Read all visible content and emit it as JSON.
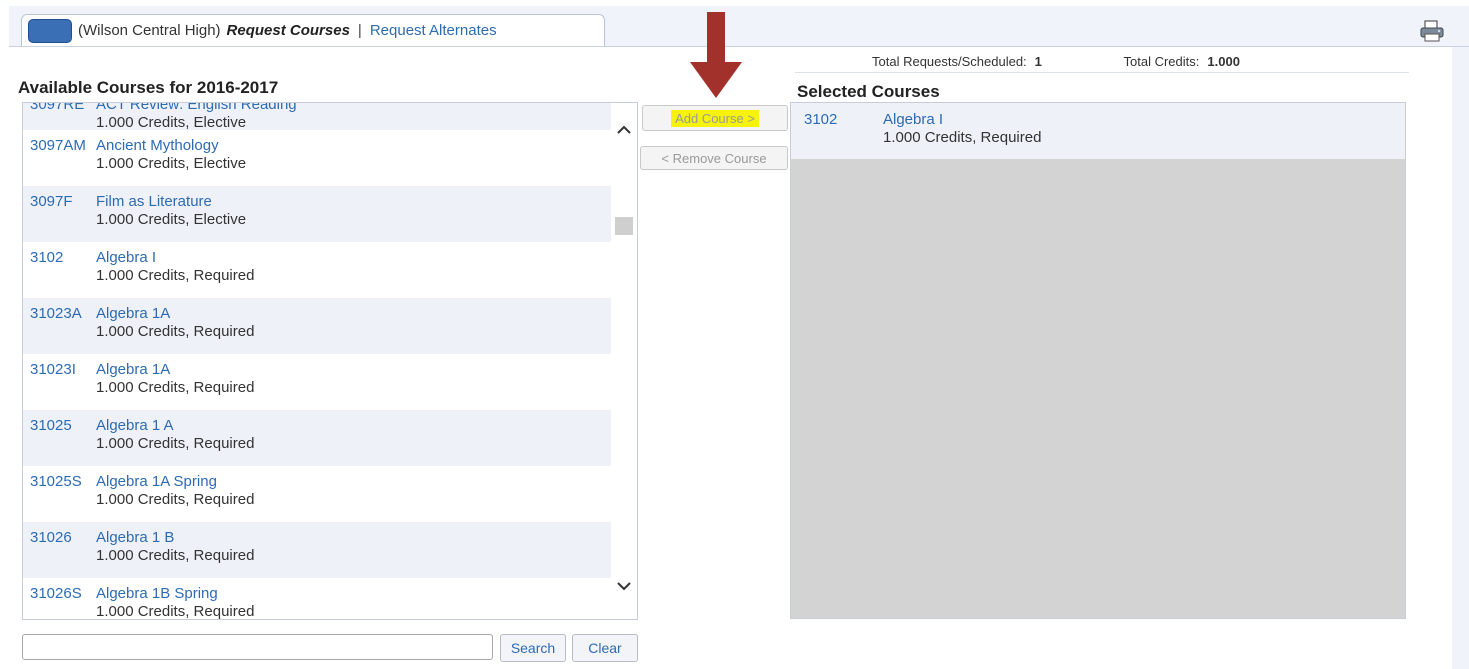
{
  "tab": {
    "school": "(Wilson Central High)",
    "active": "Request Courses",
    "separator": "|",
    "link": "Request Alternates"
  },
  "available": {
    "title": "Available Courses for 2016-2017",
    "partial_first": {
      "code": "3097RE",
      "name": "ACT Review: English Reading",
      "detail": "1.000 Credits,  Elective"
    },
    "courses": [
      {
        "code": "3097AM",
        "name": "Ancient Mythology",
        "detail": "1.000 Credits,  Elective"
      },
      {
        "code": "3097F",
        "name": "Film as Literature",
        "detail": "1.000 Credits,  Elective"
      },
      {
        "code": "3102",
        "name": "Algebra I",
        "detail": "1.000 Credits,  Required"
      },
      {
        "code": "31023A",
        "name": "Algebra 1A",
        "detail": "1.000 Credits,  Required"
      },
      {
        "code": "31023I",
        "name": "Algebra 1A",
        "detail": "1.000 Credits,  Required"
      },
      {
        "code": "31025",
        "name": "Algebra 1 A",
        "detail": "1.000 Credits,  Required"
      },
      {
        "code": "31025S",
        "name": "Algebra 1A Spring",
        "detail": "1.000 Credits,  Required"
      },
      {
        "code": "31026",
        "name": "Algebra 1 B",
        "detail": "1.000 Credits,  Required"
      },
      {
        "code": "31026S",
        "name": "Algebra 1B Spring",
        "detail": "1.000 Credits,  Required"
      }
    ]
  },
  "buttons": {
    "add": "Add Course >",
    "remove": "< Remove Course",
    "search": "Search",
    "clear": "Clear"
  },
  "totals": {
    "requests_label": "Total Requests/Scheduled:",
    "requests_value": "1",
    "credits_label": "Total Credits:",
    "credits_value": "1.000"
  },
  "selected": {
    "title": "Selected Courses",
    "courses": [
      {
        "code": "3102",
        "name": "Algebra I",
        "detail": "1.000 Credits,  Required"
      }
    ]
  },
  "search": {
    "value": "",
    "placeholder": ""
  },
  "colors": {
    "highlight": "#f6f20a",
    "arrow": "#a2312c",
    "link": "#2d6bb3"
  },
  "icons": [
    "print-icon",
    "chevron-up-icon",
    "chevron-down-icon",
    "down-arrow-icon"
  ]
}
